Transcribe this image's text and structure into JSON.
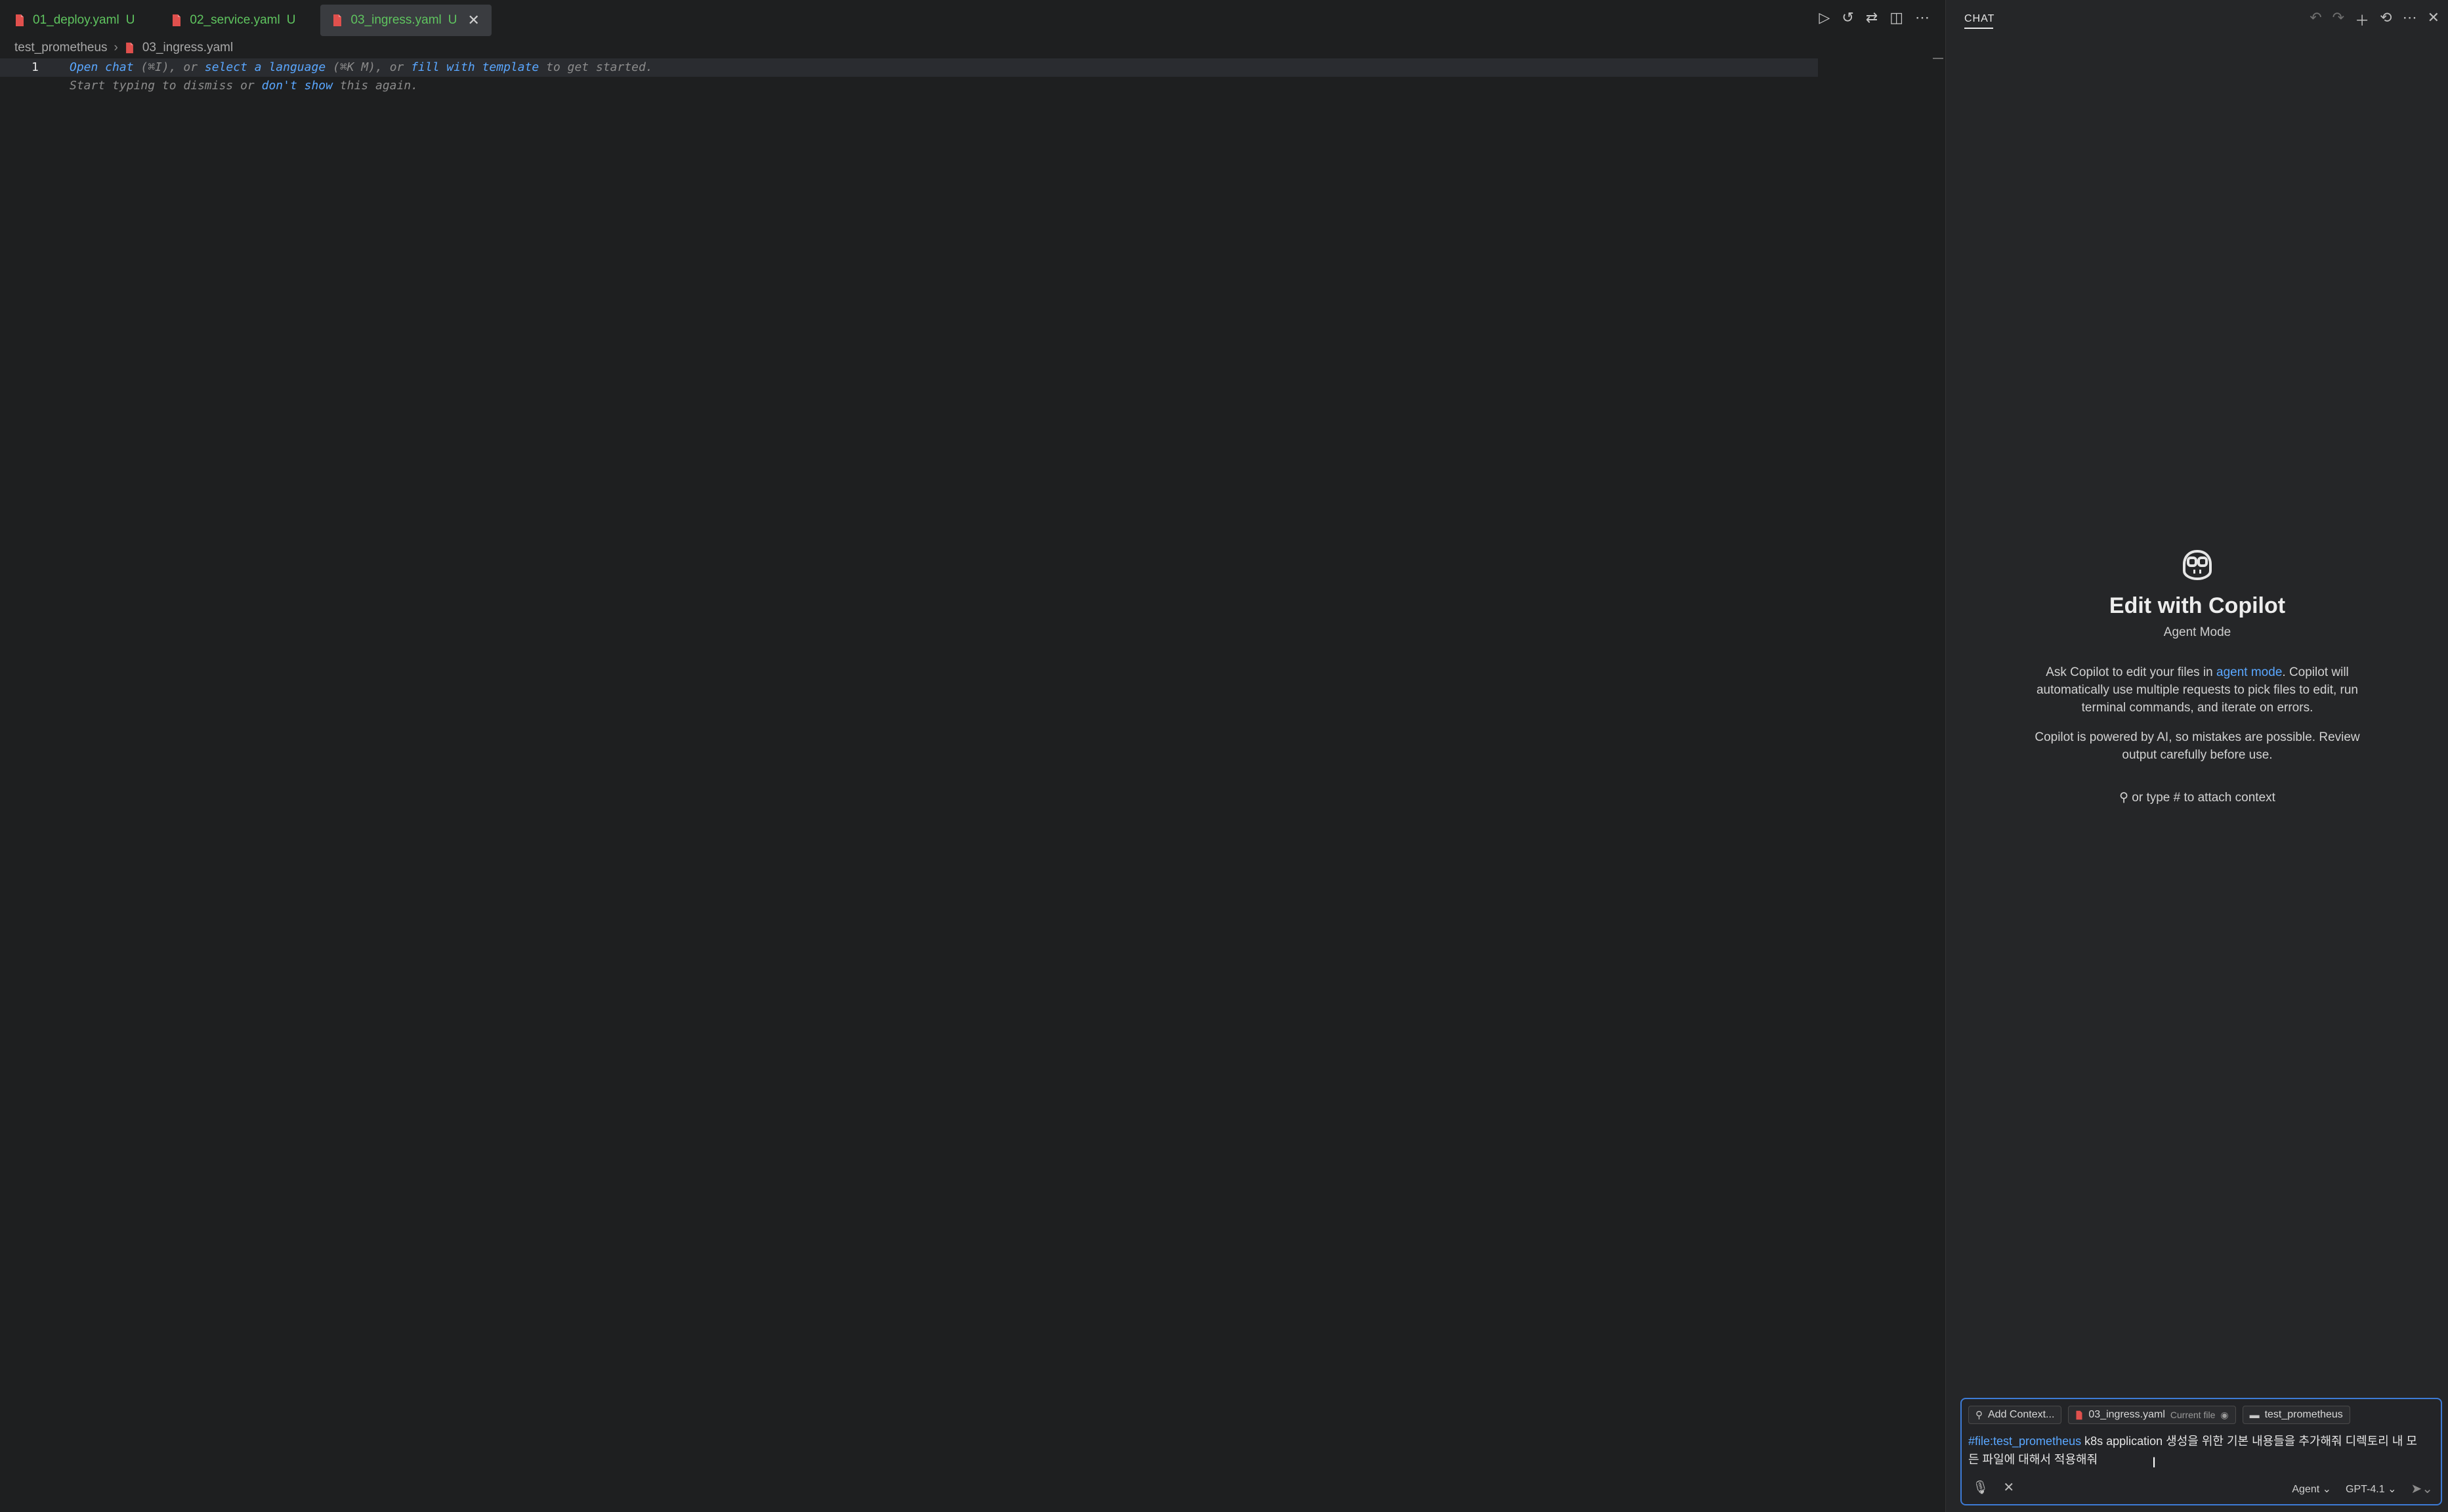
{
  "tabs": [
    {
      "label": "01_deploy.yaml",
      "status": "U",
      "active": false
    },
    {
      "label": "02_service.yaml",
      "status": "U",
      "active": false
    },
    {
      "label": "03_ingress.yaml",
      "status": "U",
      "active": true
    }
  ],
  "breadcrumb": {
    "folder": "test_prometheus",
    "file": "03_ingress.yaml"
  },
  "editor": {
    "line_number": "1",
    "hint_line1": {
      "open_chat": "Open chat",
      "shortcut1": " (⌘I), or ",
      "select_language": "select a language",
      "shortcut2": " (⌘K M), or ",
      "fill_template": "fill with template",
      "tail": " to get started."
    },
    "hint_line2": {
      "start": "Start typing to dismiss or ",
      "dont_show": "don't show",
      "tail": " this again."
    }
  },
  "chat": {
    "header": "CHAT",
    "title": "Edit with Copilot",
    "subtitle": "Agent Mode",
    "desc_pre": "Ask Copilot to edit your files in ",
    "desc_link": "agent mode",
    "desc_post": ". Copilot will automatically use multiple requests to pick files to edit, run terminal commands, and iterate on errors.",
    "disclaimer": "Copilot is powered by AI, so mistakes are possible. Review output carefully before use.",
    "attach_hint": "or type # to attach context",
    "context_chips": {
      "add": "Add Context...",
      "file": "03_ingress.yaml",
      "file_note": "Current file",
      "folder": "test_prometheus"
    },
    "prompt_ref": "#file:test_prometheus",
    "prompt_text": " k8s application 생성을 위한 기본 내용들을 추가해줘 디렉토리 내 모든 파일에 대해서 적용해줘",
    "mode": "Agent",
    "model": "GPT-4.1"
  },
  "colors": {
    "accent": "#3d7bd6",
    "link": "#5aa7ff",
    "modified": "#5fc45f",
    "file_icon": "#e0504d"
  }
}
